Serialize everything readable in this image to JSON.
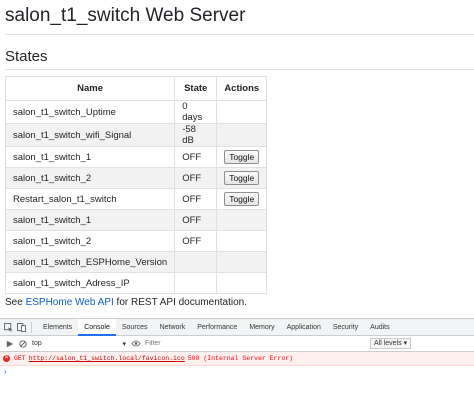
{
  "page": {
    "title": "salon_t1_switch Web Server",
    "section_title": "States"
  },
  "table": {
    "headers": [
      "Name",
      "State",
      "Actions"
    ],
    "toggle_label": "Toggle",
    "rows": [
      {
        "name": "salon_t1_switch_Uptime",
        "state": "0 days",
        "action": ""
      },
      {
        "name": "salon_t1_switch_wifi_Signal",
        "state": "-58 dB",
        "action": ""
      },
      {
        "name": "salon_t1_switch_1",
        "state": "OFF",
        "action": "Toggle"
      },
      {
        "name": "salon_t1_switch_2",
        "state": "OFF",
        "action": "Toggle"
      },
      {
        "name": "Restart_salon_t1_switch",
        "state": "OFF",
        "action": "Toggle"
      },
      {
        "name": "salon_t1_switch_1",
        "state": "OFF",
        "action": ""
      },
      {
        "name": "salon_t1_switch_2",
        "state": "OFF",
        "action": ""
      },
      {
        "name": "salon_t1_switch_ESPHome_Version",
        "state": "",
        "action": ""
      },
      {
        "name": "salon_t1_switch_Adress_IP",
        "state": "",
        "action": ""
      }
    ]
  },
  "api_note": {
    "prefix": "See ",
    "link": "ESPHome Web API",
    "suffix": " for REST API documentation."
  },
  "devtools": {
    "tabs": [
      "Elements",
      "Console",
      "Sources",
      "Network",
      "Performance",
      "Memory",
      "Application",
      "Security",
      "Audits"
    ],
    "active_tab": "Console",
    "context": "top",
    "filter_placeholder": "Filter",
    "levels": "All levels",
    "error": {
      "method": "GET",
      "url": "http://salon_t1_switch.local/favicon.ico",
      "status": "500 (Internal Server Error)"
    },
    "prompt": "›"
  },
  "colors": {
    "link": "#0b5fc7",
    "error": "#ff0000",
    "active_tab_underline": "#1a73e8"
  }
}
